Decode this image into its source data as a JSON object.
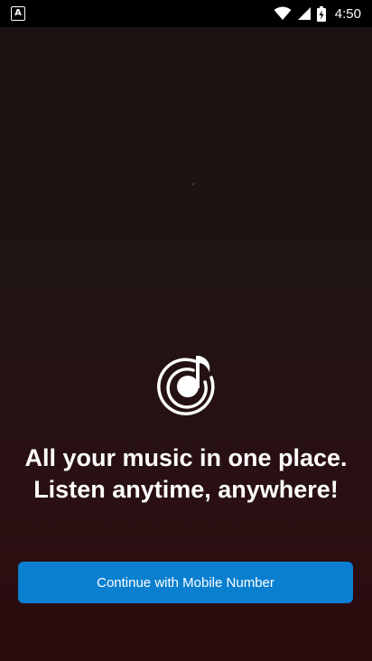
{
  "status_bar": {
    "notification_icon": "app-notification-icon",
    "notification_glyph": "A",
    "wifi_icon": "wifi-icon",
    "signal_icon": "cell-signal-icon",
    "battery_icon": "battery-charging-icon",
    "time": "4:50"
  },
  "logo": {
    "icon": "music-note-waves-icon"
  },
  "headline": {
    "line1": "All your music in one place.",
    "line2": "Listen anytime, anywhere!"
  },
  "cta": {
    "label": "Continue with Mobile Number",
    "color": "#0a7fd0"
  }
}
